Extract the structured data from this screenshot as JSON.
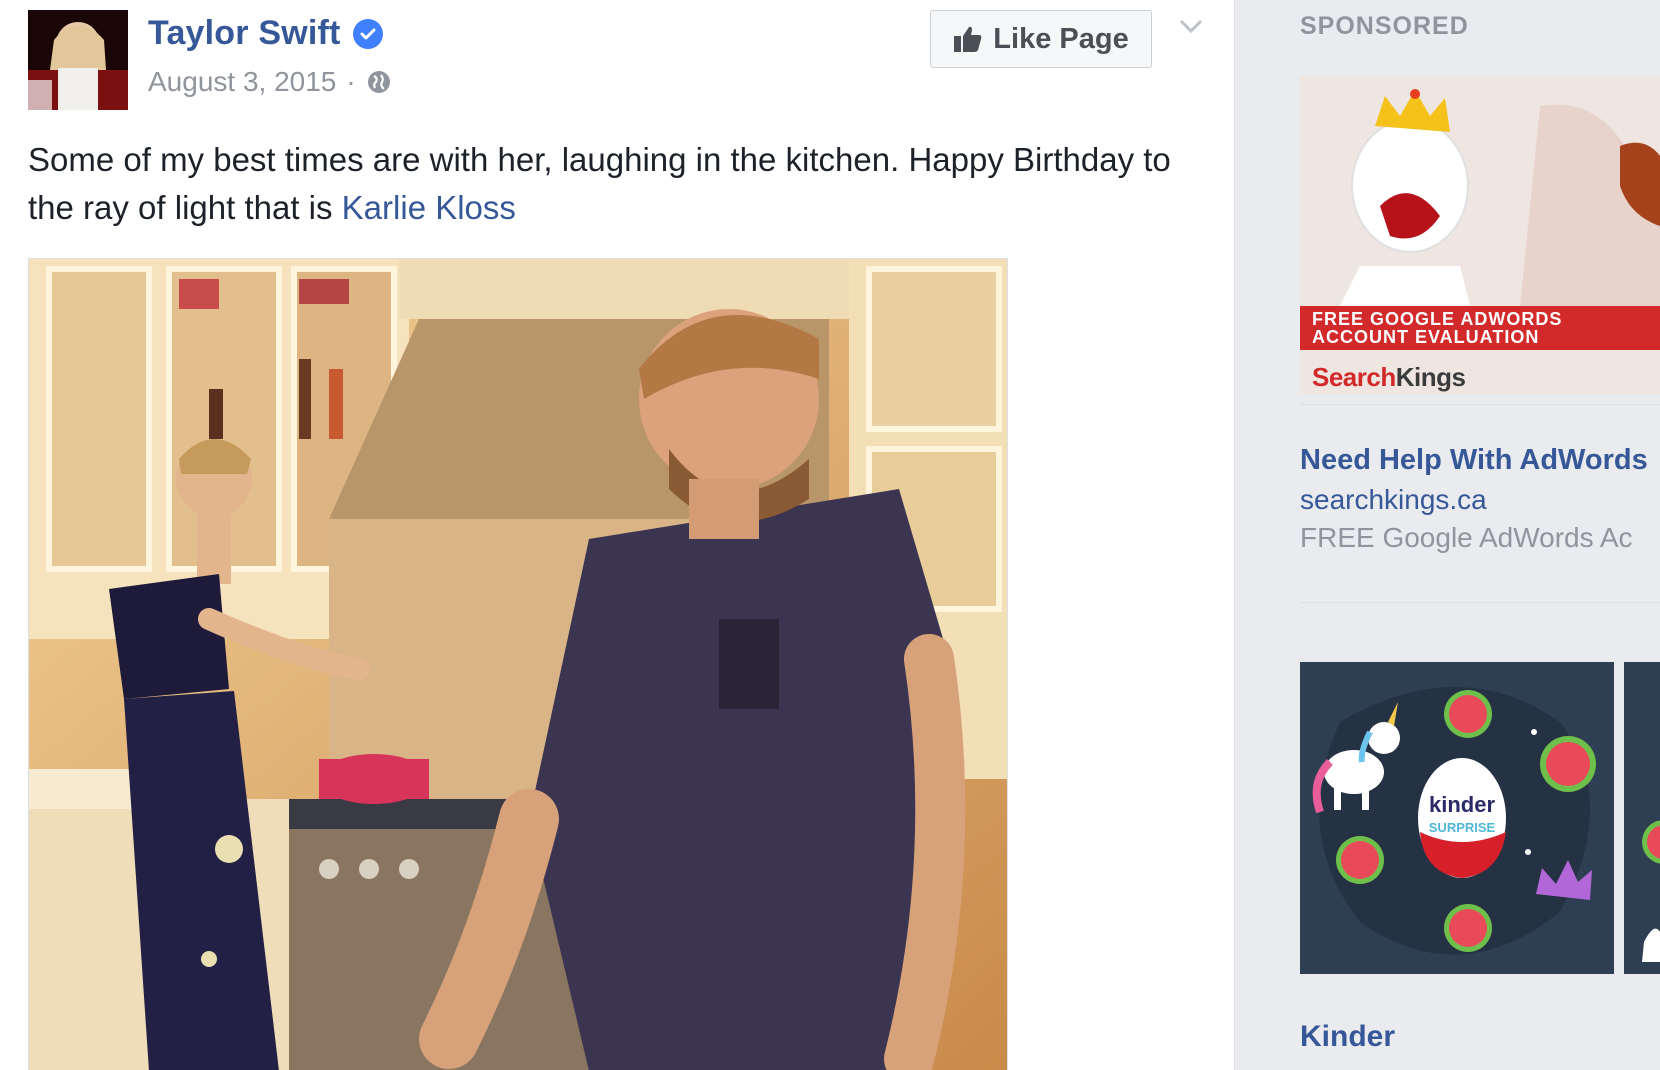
{
  "post": {
    "page_name": "Taylor Swift",
    "date": "August 3, 2015",
    "separator": "·",
    "privacy_icon": "globe-icon",
    "verified_icon": "verified-badge-icon",
    "like_button_label": "Like Page",
    "like_icon": "thumbs-up-icon",
    "menu_icon": "chevron-down-icon",
    "text_before_link": "Some of my best times are with her, laughing in the kitchen. Happy Birthday to the ray of light that is ",
    "link_text": "Karlie Kloss"
  },
  "sidebar": {
    "sponsored_label": "SPONSORED",
    "ads": [
      {
        "banner_text": "FREE GOOGLE ADWORDS ACCOUNT EVALUATION",
        "brand_part1": "Search",
        "brand_part2": "Kings",
        "title": "Need Help With AdWords",
        "url": "searchkings.ca",
        "description": "FREE Google AdWords Ac"
      },
      {
        "image_text_top": "kinder",
        "image_text_bottom": "SURPRISE",
        "title": "Kinder"
      }
    ]
  },
  "colors": {
    "link_blue": "#365899",
    "meta_gray": "#90949c",
    "background": "#e9ebee",
    "verified_blue": "#4080ff",
    "ad_red": "#d22a2a"
  }
}
